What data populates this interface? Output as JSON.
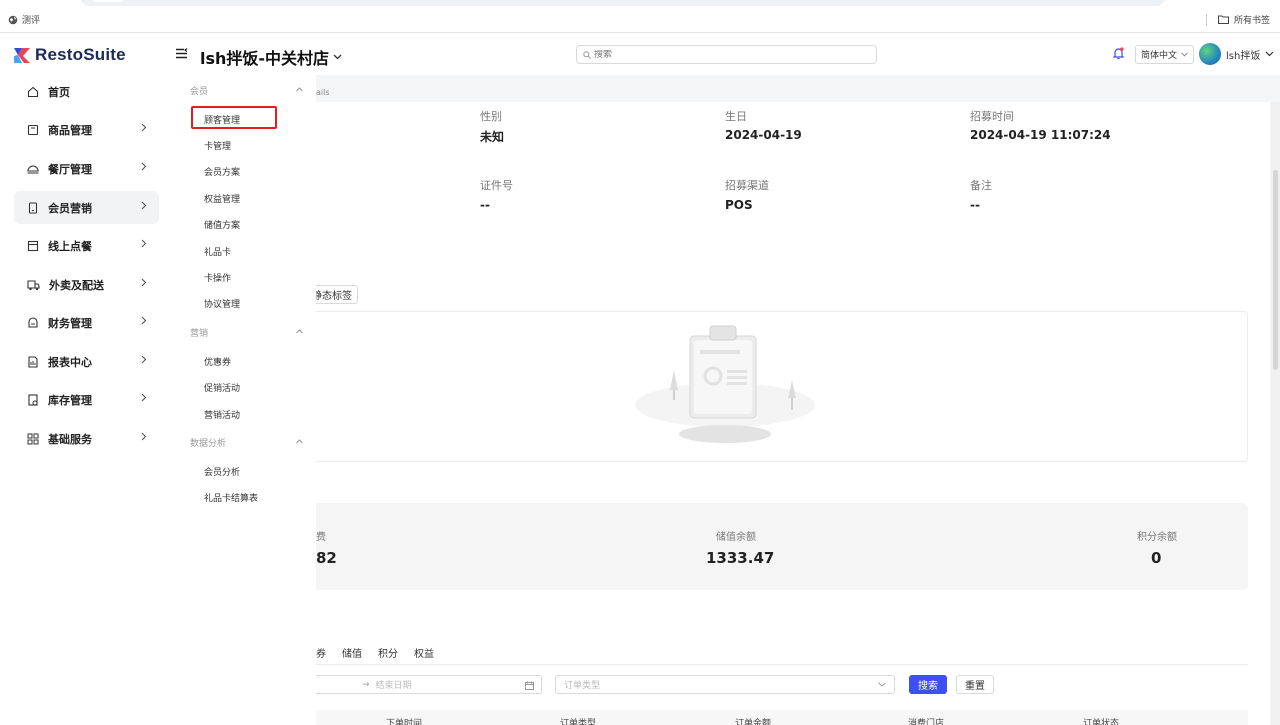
{
  "bookmarks": {
    "left_label": "测评",
    "right_label": "所有书签"
  },
  "header": {
    "logo_text": "RestoSuite",
    "store_name": "lsh拌饭-中关村店",
    "search_placeholder": "搜索",
    "language": "简体中文",
    "username": "lsh拌饭"
  },
  "sidebar": {
    "items": [
      {
        "label": "首页",
        "icon": "home-icon",
        "has_chevron": false
      },
      {
        "label": "商品管理",
        "icon": "product-icon",
        "has_chevron": true
      },
      {
        "label": "餐厅管理",
        "icon": "restaurant-icon",
        "has_chevron": true
      },
      {
        "label": "会员营销",
        "icon": "member-icon",
        "has_chevron": true,
        "active": true
      },
      {
        "label": "线上点餐",
        "icon": "online-order-icon",
        "has_chevron": true
      },
      {
        "label": "外卖及配送",
        "icon": "delivery-icon",
        "has_chevron": true
      },
      {
        "label": "财务管理",
        "icon": "finance-icon",
        "has_chevron": true
      },
      {
        "label": "报表中心",
        "icon": "report-icon",
        "has_chevron": true
      },
      {
        "label": "库存管理",
        "icon": "inventory-icon",
        "has_chevron": true
      },
      {
        "label": "基础服务",
        "icon": "grid-icon",
        "has_chevron": true
      }
    ]
  },
  "submenu": {
    "groups": [
      {
        "title": "会员",
        "items": [
          "顾客管理",
          "卡管理",
          "会员方案",
          "权益管理",
          "储值方案",
          "礼品卡",
          "卡操作",
          "协议管理"
        ]
      },
      {
        "title": "营销",
        "items": [
          "优惠券",
          "促销活动",
          "营销活动"
        ]
      },
      {
        "title": "数据分析",
        "items": [
          "会员分析",
          "礼品卡结算表"
        ]
      }
    ],
    "highlighted": "顾客管理"
  },
  "breadcrumb_fragment": "ails",
  "details": {
    "gender_label": "性别",
    "gender_value": "未知",
    "birthday_label": "生日",
    "birthday_value": "2024-04-19",
    "recruit_time_label": "招募时间",
    "recruit_time_value": "2024-04-19 11:07:24",
    "id_label": "证件号",
    "id_value": "--",
    "channel_label": "招募渠道",
    "channel_value": "POS",
    "remark_label": "备注",
    "remark_value": "--"
  },
  "tags": {
    "static_tag_button": "静态标签"
  },
  "stats": {
    "first_label_fragment": "费",
    "first_value_fragment": "82",
    "balance_label": "储值余额",
    "balance_value": "1333.47",
    "points_label": "积分余额",
    "points_value": "0"
  },
  "orders": {
    "tabs": [
      "券",
      "储值",
      "积分",
      "权益"
    ],
    "date_arrow": "→",
    "end_date_placeholder": "结束日期",
    "order_type_placeholder": "订单类型",
    "search_button": "搜索",
    "reset_button": "重置",
    "columns": [
      "下单时间",
      "订单类型",
      "订单金额",
      "消费门店",
      "订单状态"
    ]
  }
}
